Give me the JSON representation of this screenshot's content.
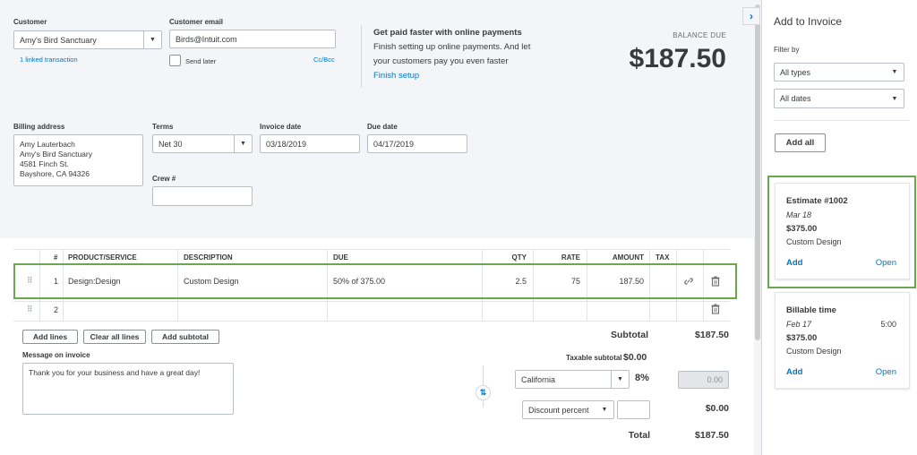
{
  "header": {
    "customer_label": "Customer",
    "customer_value": "Amy's Bird Sanctuary",
    "linked_transaction": "1 linked transaction",
    "email_label": "Customer email",
    "email_value": "Birds@Intuit.com",
    "send_later": "Send later",
    "cc_bcc": "Cc/Bcc"
  },
  "promo": {
    "title": "Get paid faster with online payments",
    "body_line1": "Finish setting up online payments. And let",
    "body_line2": "your customers pay you even faster",
    "link": "Finish setup"
  },
  "balance": {
    "label": "BALANCE DUE",
    "amount": "$187.50"
  },
  "billing": {
    "label": "Billing address",
    "line1": "Amy Lauterbach",
    "line2": "Amy's Bird Sanctuary",
    "line3": "4581 Finch St.",
    "line4": "Bayshore, CA  94326"
  },
  "terms": {
    "label": "Terms",
    "value": "Net 30"
  },
  "invoice_date": {
    "label": "Invoice date",
    "value": "03/18/2019"
  },
  "due_date": {
    "label": "Due date",
    "value": "04/17/2019"
  },
  "crew": {
    "label": "Crew #"
  },
  "table": {
    "headers": {
      "num": "#",
      "product": "PRODUCT/SERVICE",
      "description": "DESCRIPTION",
      "due": "DUE",
      "qty": "QTY",
      "rate": "RATE",
      "amount": "AMOUNT",
      "tax": "TAX"
    },
    "rows": [
      {
        "num": "1",
        "product": "Design:Design",
        "description": "Custom Design",
        "due": "50% of 375.00",
        "qty": "2.5",
        "rate": "75",
        "amount": "187.50"
      },
      {
        "num": "2"
      }
    ]
  },
  "buttons": {
    "add_lines": "Add lines",
    "clear_all": "Clear all lines",
    "add_subtotal": "Add subtotal"
  },
  "message": {
    "label": "Message on invoice",
    "value": "Thank you for your business and have a great day!"
  },
  "totals": {
    "subtotal_label": "Subtotal",
    "subtotal_value": "$187.50",
    "taxable_label": "Taxable subtotal",
    "taxable_value": "$0.00",
    "tax_region": "California",
    "tax_rate": "8%",
    "tax_amount": "0.00",
    "discount_type": "Discount percent",
    "discount_value": "$0.00",
    "total_label": "Total",
    "total_value": "$187.50"
  },
  "sidebar": {
    "title": "Add to Invoice",
    "filter_label": "Filter by",
    "type_filter": "All types",
    "date_filter": "All dates",
    "add_all": "Add all",
    "cards": [
      {
        "title": "Estimate #1002",
        "date": "Mar 18",
        "time": "",
        "amount": "$375.00",
        "desc": "Custom Design",
        "add": "Add",
        "open": "Open"
      },
      {
        "title": "Billable time",
        "date": "Feb 17",
        "time": "5:00",
        "amount": "$375.00",
        "desc": "Custom Design",
        "add": "Add",
        "open": "Open"
      }
    ]
  },
  "colors": {
    "highlight": "#6aa84f",
    "link": "#0077c5",
    "panel_bg": "#f4f5f8"
  }
}
